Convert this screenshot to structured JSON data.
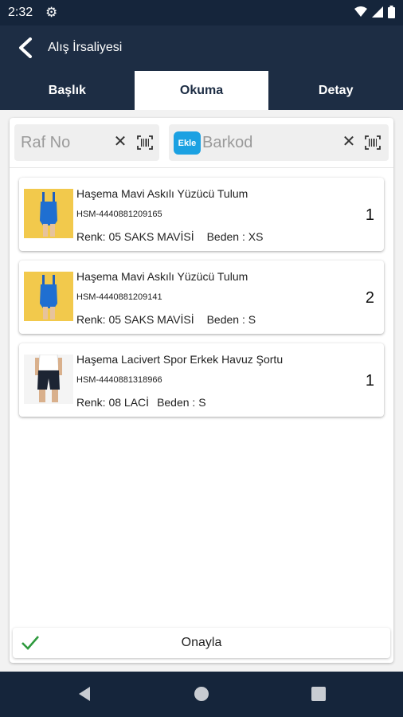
{
  "status_bar": {
    "time": "2:32"
  },
  "app_bar": {
    "title": "Alış İrsaliyesi"
  },
  "tabs": [
    {
      "label": "Başlık",
      "active": false
    },
    {
      "label": "Okuma",
      "active": true
    },
    {
      "label": "Detay",
      "active": false
    }
  ],
  "raf_field": {
    "placeholder": "Raf No",
    "value": ""
  },
  "barkod_field": {
    "placeholder": "Barkod",
    "value": "",
    "add_button_label": "Ekle"
  },
  "items": [
    {
      "name": "Haşema Mavi Askılı Yüzücü Tulum",
      "code": "HSM-4440881209165",
      "renk": "Renk: 05 SAKS MAVİSİ",
      "beden": "Beden : XS",
      "qty": "1"
    },
    {
      "name": "Haşema Mavi Askılı Yüzücü Tulum",
      "code": "HSM-4440881209141",
      "renk": "Renk: 05 SAKS MAVİSİ",
      "beden": "Beden : S",
      "qty": "2"
    },
    {
      "name": "Haşema Lacivert Spor Erkek Havuz Şortu",
      "code": "HSM-4440881318966",
      "renk": "Renk: 08 LACİ",
      "beden": "Beden : S",
      "qty": "1"
    }
  ],
  "confirm": {
    "label": "Onayla"
  },
  "colors": {
    "header": "#1d2d44",
    "status_bar": "#15253b",
    "accent": "#1ba1e2",
    "confirm_check": "#2e9a3e"
  }
}
